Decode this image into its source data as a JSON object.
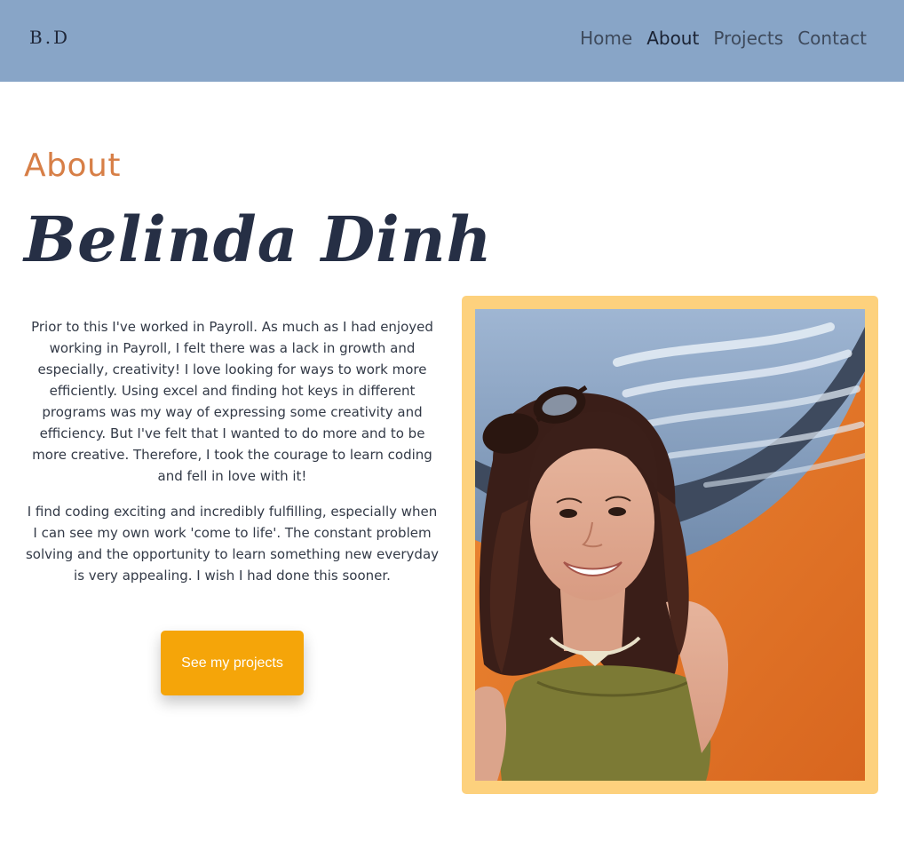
{
  "header": {
    "logo": "B.D",
    "nav": [
      {
        "label": "Home",
        "active": false
      },
      {
        "label": "About",
        "active": true
      },
      {
        "label": "Projects",
        "active": false
      },
      {
        "label": "Contact",
        "active": false
      }
    ]
  },
  "about": {
    "section_label": "About",
    "name": "Belinda Dinh",
    "paragraphs": [
      "Prior to this I've worked in Payroll. As much as I had enjoyed working in Payroll, I felt there was a lack in growth and especially, creativity! I love looking for ways to work more efficiently. Using excel and finding hot keys in different programs was my way of expressing some creativity and efficiency. But I've felt that I wanted to do more and to be more creative. Therefore, I took the courage to learn coding and fell in love with it!",
      "I find coding exciting and incredibly fulfilling, especially when I can see my own work 'come to life'. The constant problem solving and the opportunity to learn something new everyday is very appealing. I wish I had done this sooner."
    ],
    "cta_label": "See my projects"
  },
  "colors": {
    "navbar_bg": "#88a5c7",
    "accent_orange": "#d77f47",
    "button_bg": "#f5a509",
    "frame_bg": "#fdd17d",
    "title_navy": "#262f45"
  }
}
